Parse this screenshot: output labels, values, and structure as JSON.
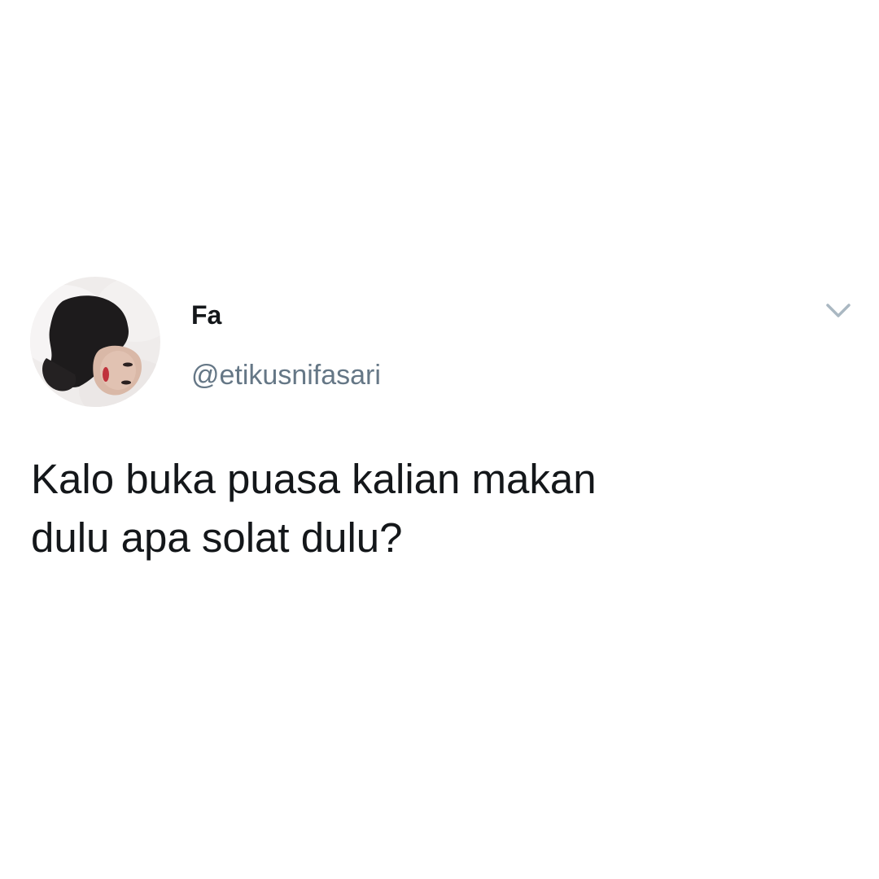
{
  "tweet": {
    "author": {
      "display_name": "Fa",
      "handle": "@etikusnifasari",
      "avatar_icon": "profile-photo"
    },
    "text": "Kalo buka puasa kalian makan\ndulu apa solat dulu?",
    "menu_icon": "chevron-down-icon"
  },
  "colors": {
    "background": "#ffffff",
    "text_primary": "#14171a",
    "text_secondary": "#657786",
    "icon": "#aab8c2"
  }
}
